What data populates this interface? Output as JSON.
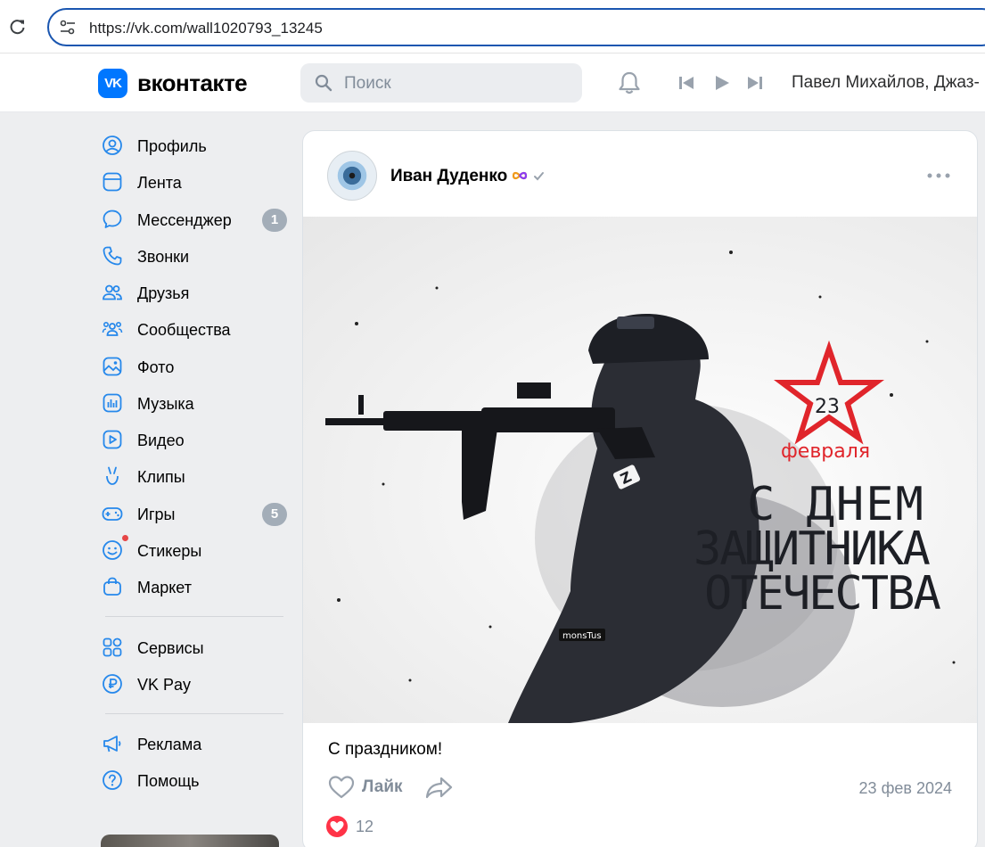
{
  "browser": {
    "url": "https://vk.com/wall1020793_13245"
  },
  "header": {
    "logo_text": "VK",
    "wordmark": "вконтакте",
    "search_placeholder": "Поиск",
    "now_playing": "Павел Михайлов, Джаз-"
  },
  "sidebar": {
    "items": [
      {
        "label": "Профиль",
        "icon": "profile-icon"
      },
      {
        "label": "Лента",
        "icon": "feed-icon"
      },
      {
        "label": "Мессенджер",
        "icon": "messenger-icon",
        "badge": "1"
      },
      {
        "label": "Звонки",
        "icon": "phone-icon"
      },
      {
        "label": "Друзья",
        "icon": "friends-icon"
      },
      {
        "label": "Сообщества",
        "icon": "communities-icon"
      },
      {
        "label": "Фото",
        "icon": "photo-icon"
      },
      {
        "label": "Музыка",
        "icon": "music-icon"
      },
      {
        "label": "Видео",
        "icon": "video-icon"
      },
      {
        "label": "Клипы",
        "icon": "clips-icon"
      },
      {
        "label": "Игры",
        "icon": "games-icon",
        "badge": "5"
      },
      {
        "label": "Стикеры",
        "icon": "stickers-icon"
      },
      {
        "label": "Маркет",
        "icon": "market-icon"
      },
      {
        "label": "Сервисы",
        "icon": "services-icon"
      },
      {
        "label": "VK Pay",
        "icon": "vkpay-icon"
      },
      {
        "label": "Реклама",
        "icon": "ads-icon"
      },
      {
        "label": "Помощь",
        "icon": "help-icon"
      }
    ]
  },
  "post": {
    "author": "Иван Дуденко",
    "image": {
      "date_number": "23",
      "month": "февраля",
      "line1": "С ДНЕМ",
      "line2": "ЗАЩИТНИКА",
      "line3": "ОТЕЧЕСТВА",
      "watermark": "monsTus",
      "patch_letter": "Z"
    },
    "text": "С праздником!",
    "like_label": "Лайк",
    "date": "23 фев 2024",
    "reaction_count": "12"
  },
  "colors": {
    "accent": "#0077ff",
    "background": "#edeef0",
    "star_red": "#e0252b",
    "like_red": "#ff3347",
    "muted": "#818c99"
  }
}
